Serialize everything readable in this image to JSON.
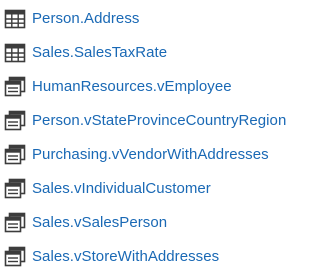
{
  "objects": [
    {
      "name": "Person.Address",
      "icon": "table-icon"
    },
    {
      "name": "Sales.SalesTaxRate",
      "icon": "table-icon"
    },
    {
      "name": "HumanResources.vEmployee",
      "icon": "view-icon"
    },
    {
      "name": "Person.vStateProvinceCountryRegion",
      "icon": "view-icon"
    },
    {
      "name": "Purchasing.vVendorWithAddresses",
      "icon": "view-icon"
    },
    {
      "name": "Sales.vIndividualCustomer",
      "icon": "view-icon"
    },
    {
      "name": "Sales.vSalesPerson",
      "icon": "view-icon"
    },
    {
      "name": "Sales.vStoreWithAddresses",
      "icon": "view-icon"
    }
  ],
  "colors": {
    "link": "#1a69b5",
    "icon": "#3c3c3c"
  }
}
